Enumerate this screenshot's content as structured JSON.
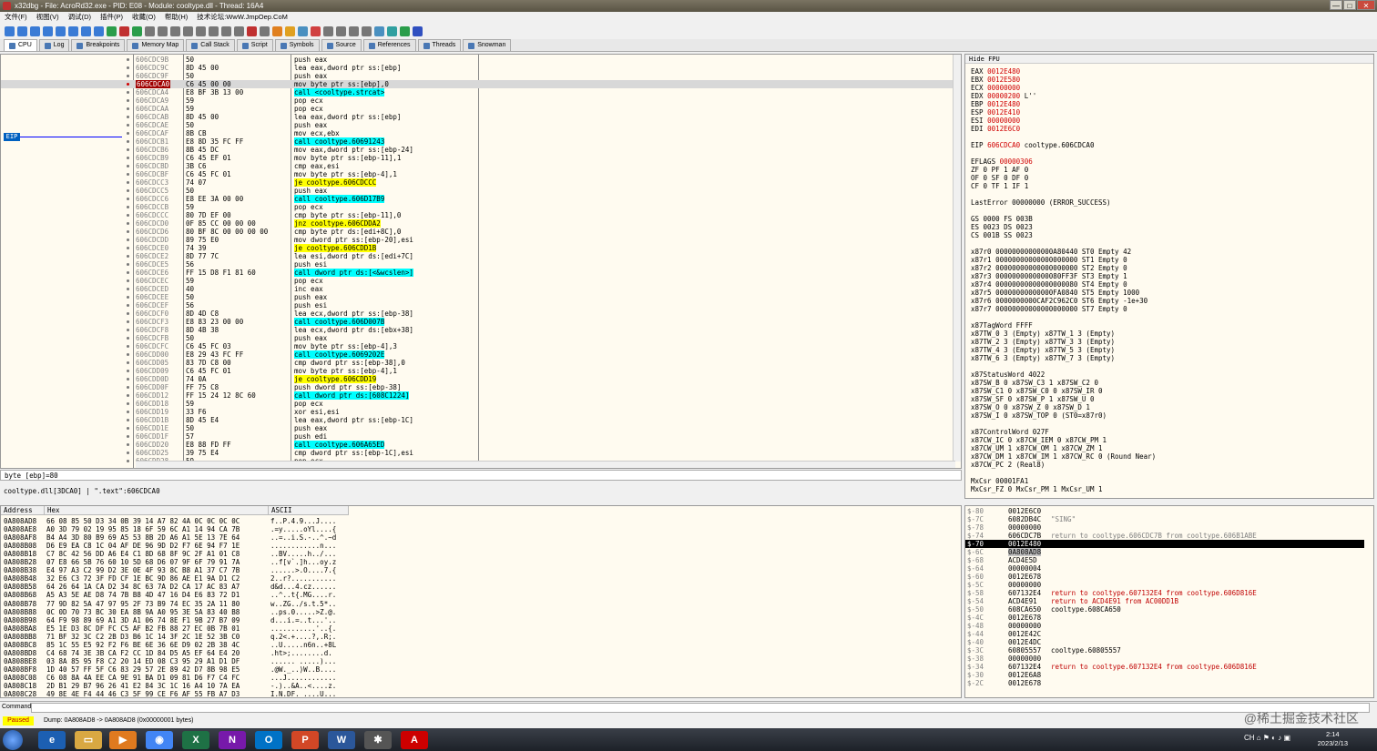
{
  "window": {
    "title": "x32dbg - File: AcroRd32.exe - PID: E08 - Module: cooltype.dll - Thread: 16A4",
    "min": "—",
    "max": "□",
    "close": "✕"
  },
  "menu": [
    "文件(F)",
    "视图(V)",
    "调试(D)",
    "插件(P)",
    "收藏(O)",
    "帮助(H)",
    "技术论坛:WwW.JmpOep.CoM"
  ],
  "tabs": [
    {
      "label": "CPU",
      "active": true
    },
    {
      "label": "Log"
    },
    {
      "label": "Breakpoints"
    },
    {
      "label": "Memory Map"
    },
    {
      "label": "Call Stack"
    },
    {
      "label": "Script"
    },
    {
      "label": "Symbols"
    },
    {
      "label": "Source"
    },
    {
      "label": "References"
    },
    {
      "label": "Threads"
    },
    {
      "label": "Snowman"
    }
  ],
  "disasm": {
    "eip_label": "EIP",
    "rows": [
      {
        "a": "606CDC9B",
        "b": "50",
        "i": "push eax",
        "t": "n"
      },
      {
        "a": "606CDC9C",
        "b": "8D 45 00",
        "i": "lea eax,dword ptr ss:[ebp]",
        "t": "n"
      },
      {
        "a": "606CDC9F",
        "b": "50",
        "i": "push eax",
        "t": "n"
      },
      {
        "a": "606CDCA0",
        "b": "C6 45 00 00",
        "i": "mov byte ptr ss:[ebp],0",
        "t": "eip"
      },
      {
        "a": "606CDCA4",
        "b": "E8 BF 3B 13 00",
        "i": "call <cooltype.strcat>",
        "t": "call"
      },
      {
        "a": "606CDCA9",
        "b": "59",
        "i": "pop ecx",
        "t": "n"
      },
      {
        "a": "606CDCAA",
        "b": "59",
        "i": "pop ecx",
        "t": "n"
      },
      {
        "a": "606CDCAB",
        "b": "8D 45 00",
        "i": "lea eax,dword ptr ss:[ebp]",
        "t": "n"
      },
      {
        "a": "606CDCAE",
        "b": "50",
        "i": "push eax",
        "t": "n"
      },
      {
        "a": "606CDCAF",
        "b": "8B CB",
        "i": "mov ecx,ebx",
        "t": "n"
      },
      {
        "a": "606CDCB1",
        "b": "E8 8D 35 FC FF",
        "i": "call cooltype.60691243",
        "t": "call"
      },
      {
        "a": "606CDCB6",
        "b": "8B 45 DC",
        "i": "mov eax,dword ptr ss:[ebp-24]",
        "t": "n"
      },
      {
        "a": "606CDCB9",
        "b": "C6 45 EF 01",
        "i": "mov byte ptr ss:[ebp-11],1",
        "t": "n"
      },
      {
        "a": "606CDCBD",
        "b": "3B C6",
        "i": "cmp eax,esi",
        "t": "n"
      },
      {
        "a": "606CDCBF",
        "b": "C6 45 FC 01",
        "i": "mov byte ptr ss:[ebp-4],1",
        "t": "n"
      },
      {
        "a": "606CDCC3",
        "b": "74 07",
        "i": "je cooltype.606CDCCC",
        "t": "jmp"
      },
      {
        "a": "606CDCC5",
        "b": "50",
        "i": "push eax",
        "t": "n"
      },
      {
        "a": "606CDCC6",
        "b": "E8 EE 3A 00 00",
        "i": "call cooltype.606D17B9",
        "t": "call"
      },
      {
        "a": "606CDCCB",
        "b": "59",
        "i": "pop ecx",
        "t": "n"
      },
      {
        "a": "606CDCCC",
        "b": "80 7D EF 00",
        "i": "cmp byte ptr ss:[ebp-11],0",
        "t": "n"
      },
      {
        "a": "606CDCD0",
        "b": "0F 85 CC 00 00 00",
        "i": "jnz cooltype.606CDDA2",
        "t": "jmp"
      },
      {
        "a": "606CDCD6",
        "b": "80 BF 8C 00 00 00 00",
        "i": "cmp byte ptr ds:[edi+8C],0",
        "t": "n"
      },
      {
        "a": "606CDCDD",
        "b": "89 75 E0",
        "i": "mov dword ptr ss:[ebp-20],esi",
        "t": "n"
      },
      {
        "a": "606CDCE0",
        "b": "74 39",
        "i": "je cooltype.606CDD1B",
        "t": "jmp"
      },
      {
        "a": "606CDCE2",
        "b": "8D 77 7C",
        "i": "lea esi,dword ptr ds:[edi+7C]",
        "t": "n"
      },
      {
        "a": "606CDCE5",
        "b": "56",
        "i": "push esi",
        "t": "n"
      },
      {
        "a": "606CDCE6",
        "b": "FF 15 D8 F1 81 60",
        "i": "call dword ptr ds:[<&wcslen>]",
        "t": "call"
      },
      {
        "a": "606CDCEC",
        "b": "59",
        "i": "pop ecx",
        "t": "n"
      },
      {
        "a": "606CDCED",
        "b": "40",
        "i": "inc eax",
        "t": "n"
      },
      {
        "a": "606CDCEE",
        "b": "50",
        "i": "push eax",
        "t": "n"
      },
      {
        "a": "606CDCEF",
        "b": "56",
        "i": "push esi",
        "t": "n"
      },
      {
        "a": "606CDCF0",
        "b": "8D 4D C8",
        "i": "lea ecx,dword ptr ss:[ebp-38]",
        "t": "n"
      },
      {
        "a": "606CDCF3",
        "b": "E8 83 23 00 00",
        "i": "call cooltype.606D007B",
        "t": "call"
      },
      {
        "a": "606CDCF8",
        "b": "8D 4B 38",
        "i": "lea ecx,dword ptr ds:[ebx+38]",
        "t": "n"
      },
      {
        "a": "606CDCFB",
        "b": "50",
        "i": "push eax",
        "t": "n"
      },
      {
        "a": "606CDCFC",
        "b": "C6 45 FC 03",
        "i": "mov byte ptr ss:[ebp-4],3",
        "t": "n"
      },
      {
        "a": "606CDD00",
        "b": "E8 29 43 FC FF",
        "i": "call cooltype.6069202E",
        "t": "call"
      },
      {
        "a": "606CDD05",
        "b": "83 7D C8 00",
        "i": "cmp dword ptr ss:[ebp-38],0",
        "t": "n"
      },
      {
        "a": "606CDD09",
        "b": "C6 45 FC 01",
        "i": "mov byte ptr ss:[ebp-4],1",
        "t": "n"
      },
      {
        "a": "606CDD0D",
        "b": "74 0A",
        "i": "je cooltype.606CDD19",
        "t": "jmp"
      },
      {
        "a": "606CDD0F",
        "b": "FF 75 C8",
        "i": "push dword ptr ss:[ebp-38]",
        "t": "n"
      },
      {
        "a": "606CDD12",
        "b": "FF 15 24 12 8C 60",
        "i": "call dword ptr ds:[608C1224]",
        "t": "call"
      },
      {
        "a": "606CDD18",
        "b": "59",
        "i": "pop ecx",
        "t": "n"
      },
      {
        "a": "606CDD19",
        "b": "33 F6",
        "i": "xor esi,esi",
        "t": "n"
      },
      {
        "a": "606CDD1B",
        "b": "8D 45 E4",
        "i": "lea eax,dword ptr ss:[ebp-1C]",
        "t": "n"
      },
      {
        "a": "606CDD1E",
        "b": "50",
        "i": "push eax",
        "t": "n"
      },
      {
        "a": "606CDD1F",
        "b": "57",
        "i": "push edi",
        "t": "n"
      },
      {
        "a": "606CDD20",
        "b": "E8 88 FD FF",
        "i": "call cooltype.606A65ED",
        "t": "call"
      },
      {
        "a": "606CDD25",
        "b": "39 75 E4",
        "i": "cmp dword ptr ss:[ebp-1C],esi",
        "t": "n"
      },
      {
        "a": "606CDD28",
        "b": "59",
        "i": "pop ecx",
        "t": "n"
      }
    ]
  },
  "info": {
    "line1": "byte [ebp]=80",
    "line2": "cooltype.dll[3DCA0] | \".text\":606CDCA0"
  },
  "registers": {
    "header": "Hide FPU",
    "lines": [
      [
        "EAX     0012E480",
        ""
      ],
      [
        "EBX     0012E580",
        ""
      ],
      [
        "ECX     00000000",
        ""
      ],
      [
        "EDX     00000200        L''",
        ""
      ],
      [
        "EBP     0012E480",
        ""
      ],
      [
        "ESP     0012E410",
        ""
      ],
      [
        "ESI     00000000",
        ""
      ],
      [
        "EDI     0012E6C0",
        ""
      ],
      [
        "",
        ""
      ],
      [
        "EIP     606CDCA0      cooltype.606CDCA0",
        ""
      ],
      [
        "",
        ""
      ],
      [
        "EFLAGS    00000306",
        ""
      ],
      [
        "ZF 0  PF 1  AF 0",
        ""
      ],
      [
        "OF 0  SF 0  DF 0",
        ""
      ],
      [
        "CF 0  TF 1  IF 1",
        ""
      ],
      [
        "",
        ""
      ],
      [
        "LastError 00000000 (ERROR_SUCCESS)",
        ""
      ],
      [
        "",
        ""
      ],
      [
        "GS 0000  FS 003B",
        ""
      ],
      [
        "ES 0023  DS 0023",
        ""
      ],
      [
        "CS 001B  SS 0023",
        ""
      ],
      [
        "",
        ""
      ],
      [
        "x87r0 00000000000000A80440 ST0 Empty 42",
        ""
      ],
      [
        "x87r1 00000000000000000000 ST1 Empty 0",
        ""
      ],
      [
        "x87r2 00000000000000000000 ST2 Empty 0",
        ""
      ],
      [
        "x87r3 0000000000000080FF3F ST3 Empty 1",
        ""
      ],
      [
        "x87r4 00000000000000000080 ST4 Empty 0",
        ""
      ],
      [
        "x87r5 00000000000000FA0840 ST5 Empty 1000",
        ""
      ],
      [
        "x87r6 0000000000CAF2C962C0 ST6 Empty -1e+30",
        ""
      ],
      [
        "x87r7 00000000000000000000 ST7 Empty 0",
        ""
      ],
      [
        "",
        ""
      ],
      [
        "x87TagWord FFFF",
        ""
      ],
      [
        "x87TW_0 3 (Empty)   x87TW_1 3 (Empty)",
        ""
      ],
      [
        "x87TW_2 3 (Empty)   x87TW_3 3 (Empty)",
        ""
      ],
      [
        "x87TW_4 3 (Empty)   x87TW_5 3 (Empty)",
        ""
      ],
      [
        "x87TW_6 3 (Empty)   x87TW_7 3 (Empty)",
        ""
      ],
      [
        "",
        ""
      ],
      [
        "x87StatusWord 4022",
        ""
      ],
      [
        "x87SW_B  0  x87SW_C3  1  x87SW_C2  0",
        ""
      ],
      [
        "x87SW_C1 0  x87SW_C0  0  x87SW_IR  0",
        ""
      ],
      [
        "x87SW_SF 0  x87SW_P   1  x87SW_U   0",
        ""
      ],
      [
        "x87SW_O  0  x87SW_Z   0  x87SW_D   1",
        ""
      ],
      [
        "x87SW_I  0  x87SW_TOP 0  (ST0=x87r0)",
        ""
      ],
      [
        "",
        ""
      ],
      [
        "x87ControlWord 027F",
        ""
      ],
      [
        "x87CW_IC 0  x87CW_IEM 0  x87CW_PM  1",
        ""
      ],
      [
        "x87CW_UM 1  x87CW_OM  1  x87CW_ZM  1",
        ""
      ],
      [
        "x87CW_DM 1  x87CW_IM  1  x87CW_RC  0 (Round Near)",
        ""
      ],
      [
        "x87CW_PC 2 (Real8)",
        ""
      ],
      [
        "",
        ""
      ],
      [
        "MxCsr 00001FA1",
        ""
      ],
      [
        "MxCsr_FZ 0  MxCsr_PM  1  MxCsr_UM  1",
        ""
      ]
    ]
  },
  "dump": {
    "headers": [
      "Address",
      "Hex",
      "ASCII"
    ],
    "rows": [
      {
        "a": "0A808AD8",
        "h": "66 08 85 50 D3 34 0B 39 14 A7 82 4A 0C 0C 0C 0C",
        "s": "f..P.4.9...J...."
      },
      {
        "a": "0A808AE8",
        "h": "A0 3D 79 02 19 95 85 18 6F 59 6C A1 14 94 CA 7B",
        "s": ".=y.....oYl....{"
      },
      {
        "a": "0A808AF8",
        "h": "B4 A4 3D 80 B9 69 A5 53 8B 2D A6 A1 5E 13 7E 64",
        "s": "..=..i.S.-..^.~d"
      },
      {
        "a": "0A808B08",
        "h": "D6 E9 EA C8 1C 04 AF DE 96 9D D2 F7 6E 94 F7 1E",
        "s": "............n..."
      },
      {
        "a": "0A808B18",
        "h": "C7 8C 42 56 DD A6 E4 C1 8D 68 8F 9C 2F A1 01 C8",
        "s": "..BV.....h../..."
      },
      {
        "a": "0A808B28",
        "h": "07 E8 66 5B 76 60 10 5D 68 D6 07 9F 6F 79 91 7A",
        "s": "..f[v`.]h...oy.z"
      },
      {
        "a": "0A808B38",
        "h": "E4 97 A3 C2 99 D2 3E 0E 4F 93 8C B8 A1 37 C7 7B",
        "s": "......>.O....7.{"
      },
      {
        "a": "0A808B48",
        "h": "32 E6 C3 72 3F FD CF 1E BC 9D 86 AE E1 9A D1 C2",
        "s": "2..r?..........."
      },
      {
        "a": "0A808B58",
        "h": "64 26 64 1A CA D2 34 8C 63 7A D2 CA 17 AC 83 A7",
        "s": "d&d...4.cz......"
      },
      {
        "a": "0A808B68",
        "h": "A5 A3 5E AE D8 74 7B B8 4D 47 16 D4 E6 83 72 D1",
        "s": "..^..t{.MG....r."
      },
      {
        "a": "0A808B78",
        "h": "77 9D 82 5A 47 97 95 2F 73 B9 74 EC 35 2A 11 80",
        "s": "w..ZG../s.t.5*.."
      },
      {
        "a": "0A808B88",
        "h": "0C 0D 70 73 BC 30 EA 8B 9A A0 95 3E 5A 83 40 B8",
        "s": "..ps.0.....>Z.@."
      },
      {
        "a": "0A808B98",
        "h": "64 F9 98 89 69 A1 3D A1 06 74 8E F1 9B 27 B7 09",
        "s": "d...i.=..t...'.."
      },
      {
        "a": "0A808BA8",
        "h": "E5 1E D3 8C DF FC C5 AF B2 FB 88 27 EC 0B 7B 01",
        "s": "...........'..{."
      },
      {
        "a": "0A808BB8",
        "h": "71 BF 32 3C C2 2B D3 B6 1C 14 3F 2C 1E 52 3B C0",
        "s": "q.2<.+....?,.R;."
      },
      {
        "a": "0A808BC8",
        "h": "85 1C 55 E5 92 F2 F6 BE 6E 36 6E D9 02 2B 38 4C",
        "s": "..U.....n6n..+8L"
      },
      {
        "a": "0A808BD8",
        "h": "C4 68 74 3E 3B CA F2 CC 1D 84 D5 A5 EF 64 E4 20",
        "s": ".ht>;........d. "
      },
      {
        "a": "0A808BE8",
        "h": "03 8A 85 95 F8 C2 20 14 ED 08 C3 95 29 A1 D1 DF",
        "s": "...... .....)..."
      },
      {
        "a": "0A808BF8",
        "h": "1D 40 57 FF 5F C6 83 29 57 2E 89 42 D7 8B 98 E5",
        "s": ".@W._..)W..B...."
      },
      {
        "a": "0A808C08",
        "h": "C6 08 8A 4A EE CA 9E 91 BA D1 09 81 D6 F7 C4 FC",
        "s": "...J............"
      },
      {
        "a": "0A808C18",
        "h": "2D B1 29 B7 96 26 41 E2 84 3C 1C 16 A4 10 7A EA",
        "s": "-.)..&A..<....z."
      },
      {
        "a": "0A808C28",
        "h": "49 8E 4E F4 44 46 C3 5F 99 CE F6 AF 55 FB A7 D3",
        "s": "I.N.DF._....U..."
      }
    ]
  },
  "stack": {
    "rows": [
      {
        "o": "$-80",
        "v": "0012E6C0",
        "c": "",
        "t": "n"
      },
      {
        "o": "$-7C",
        "v": "6082DB4C",
        "c": "\"SING\"",
        "t": "g"
      },
      {
        "o": "$-78",
        "v": "00000000",
        "c": "",
        "t": "n"
      },
      {
        "o": "$-74",
        "v": "606CDC7B",
        "c": "return to cooltype.606CDC7B from cooltype.606B1ABE",
        "t": "g"
      },
      {
        "o": "$-70",
        "v": "0012E480",
        "c": "",
        "t": "cur"
      },
      {
        "o": "$-6C",
        "v": "0A808AD8",
        "c": "",
        "t": "sel"
      },
      {
        "o": "$-68",
        "v": "ACD4E5D",
        "c": "",
        "t": "n"
      },
      {
        "o": "$-64",
        "v": "00000004",
        "c": "",
        "t": "n"
      },
      {
        "o": "$-60",
        "v": "0012E678",
        "c": "",
        "t": "n"
      },
      {
        "o": "$-5C",
        "v": "00000000",
        "c": "",
        "t": "n"
      },
      {
        "o": "$-58",
        "v": "607132E4",
        "c": "return to cooltype.607132E4 from cooltype.606D816E",
        "t": "r"
      },
      {
        "o": "$-54",
        "v": "ACD4E91",
        "c": "return to ACD4E91 from AC00DD1B",
        "t": "r"
      },
      {
        "o": "$-50",
        "v": "608CA650",
        "c": "cooltype.608CA650",
        "t": "n"
      },
      {
        "o": "$-4C",
        "v": "0012E678",
        "c": "",
        "t": "n"
      },
      {
        "o": "$-48",
        "v": "00000000",
        "c": "",
        "t": "n"
      },
      {
        "o": "$-44",
        "v": "0012E42C",
        "c": "",
        "t": "n"
      },
      {
        "o": "$-40",
        "v": "0012E4DC",
        "c": "",
        "t": "n"
      },
      {
        "o": "$-3C",
        "v": "60805557",
        "c": "cooltype.60805557",
        "t": "n"
      },
      {
        "o": "$-38",
        "v": "00000000",
        "c": "",
        "t": "n"
      },
      {
        "o": "$-34",
        "v": "607132E4",
        "c": "return to cooltype.607132E4 from cooltype.606D816E",
        "t": "r"
      },
      {
        "o": "$-30",
        "v": "0012E6A8",
        "c": "",
        "t": "n"
      },
      {
        "o": "$-2C",
        "v": "0012E678",
        "c": "",
        "t": "n"
      }
    ]
  },
  "cmd": {
    "label": "Command:"
  },
  "status": {
    "state": "Paused",
    "message": "Dump: 0A808AD8 -> 0A808AD8 (0x00000001 bytes)"
  },
  "watermark": "@稀土掘金技术社区",
  "taskbar": {
    "time": "2:14",
    "date": "2023/2/13",
    "tray": "CH ⌂ ⚑ ◐ ♪ ▣"
  }
}
